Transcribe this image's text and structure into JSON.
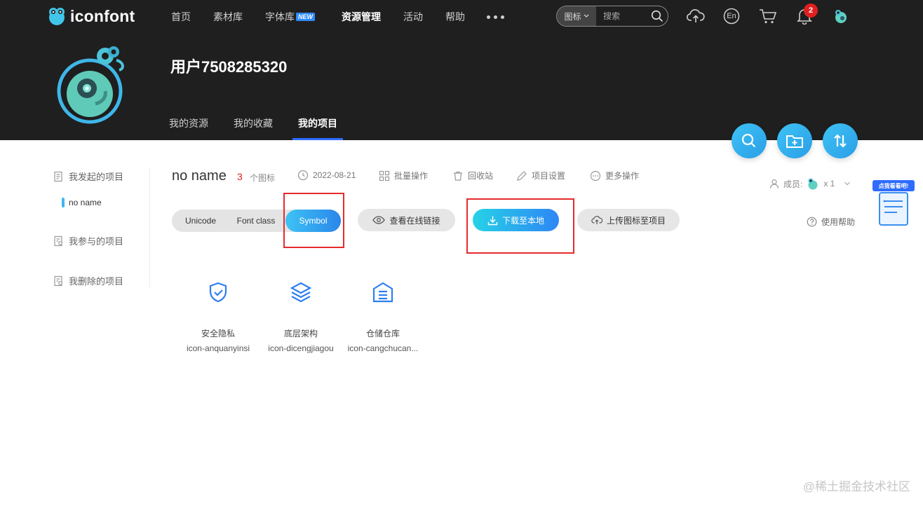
{
  "brand": {
    "name": "iconfont"
  },
  "nav": {
    "items": [
      {
        "label": "首页"
      },
      {
        "label": "素材库"
      },
      {
        "label": "字体库",
        "badge": "NEW"
      },
      {
        "label": "资源管理"
      },
      {
        "label": "活动"
      },
      {
        "label": "帮助"
      }
    ]
  },
  "search": {
    "type_label": "图标",
    "placeholder": "搜索"
  },
  "header_icons": {
    "lang_label": "En",
    "notification_count": "2"
  },
  "profile": {
    "username": "用户7508285320",
    "tabs": [
      {
        "label": "我的资源"
      },
      {
        "label": "我的收藏"
      },
      {
        "label": "我的项目"
      }
    ]
  },
  "sidebar": {
    "groups": [
      {
        "label": "我发起的项目",
        "children": [
          {
            "label": "no name"
          }
        ]
      },
      {
        "label": "我参与的项目"
      },
      {
        "label": "我删除的项目"
      }
    ]
  },
  "project": {
    "title": "no name",
    "icon_count": "3",
    "icon_count_unit": "个图标",
    "date": "2022-08-21",
    "actions": {
      "batch": "批量操作",
      "recycle": "回收站",
      "settings": "项目设置",
      "more": "更多操作"
    },
    "members_label": "成员:",
    "members_count": "x 1",
    "help_label": "使用帮助"
  },
  "toolbar": {
    "formats": [
      {
        "label": "Unicode"
      },
      {
        "label": "Font class"
      },
      {
        "label": "Symbol"
      }
    ],
    "active_format": "Symbol",
    "view_link": "查看在线链接",
    "download": "下载至本地",
    "upload": "上传图标至项目"
  },
  "floating_helper": {
    "tag": "点我看看吧!"
  },
  "icons": [
    {
      "name_cn": "安全隐私",
      "code": "icon-anquanyinsi",
      "icon": "shield-check-icon"
    },
    {
      "name_cn": "底层架构",
      "code": "icon-dicengjiagou",
      "icon": "layers-icon"
    },
    {
      "name_cn": "仓储仓库",
      "code": "icon-cangchucan...",
      "icon": "warehouse-icon"
    }
  ],
  "colors": {
    "header_bg": "#1f1f1f",
    "accent": "#2a9ee6",
    "highlight": "#e42b2b",
    "icon_blue": "#2e7ff0"
  },
  "watermark": "@稀土掘金技术社区"
}
